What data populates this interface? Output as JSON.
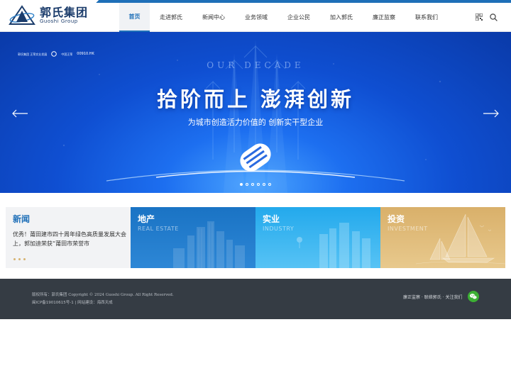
{
  "brand": {
    "name_cn": "郭氏集团",
    "name_en": "Guoshi Group"
  },
  "nav": {
    "items": [
      {
        "label": "首页",
        "active": true
      },
      {
        "label": "走进郭氏",
        "active": false
      },
      {
        "label": "新闻中心",
        "active": false
      },
      {
        "label": "业务领域",
        "active": false
      },
      {
        "label": "企业公民",
        "active": false
      },
      {
        "label": "加入郭氏",
        "active": false
      },
      {
        "label": "廉正监察",
        "active": false
      },
      {
        "label": "联系我们",
        "active": false
      }
    ],
    "qr_icon": "qr-code-icon",
    "search_icon": "search-icon"
  },
  "banner": {
    "partner_text": "郭氏集团 正荣实业发展",
    "partner_brand": "中国正荣",
    "stock_code": "00910.HK",
    "decade": "OUR DECADE",
    "title": "拾阶而上 澎湃创新",
    "subtitle": "为城市创造活力价值的 创新实干型企业",
    "slides": 6,
    "active_slide": 0
  },
  "cards": {
    "news": {
      "title": "新闻",
      "text": "优秀！莆田建市四十周年绿色高质量发展大会上，郭加迪荣获“莆田市荣誉市"
    },
    "estate": {
      "title": "地产",
      "en": "REAL ESTATE"
    },
    "industry": {
      "title": "实业",
      "en": "INDUSTRY"
    },
    "invest": {
      "title": "投资",
      "en": "INVESTMENT"
    }
  },
  "footer": {
    "copyright": "版权所有：郭氏集团 Copyright © 2024 Guoshi Group. All Right Reserved.",
    "icp": "闽ICP备19010615号-1 | 网站建设：海西天成",
    "links": "廉正监察 · 联络郭氏 · 关注我们",
    "wechat_icon": "wechat-icon"
  },
  "colors": {
    "accent": "#1e6fb8",
    "banner_blue": "#0f4fd2",
    "estate": "#1a73c4",
    "industry": "#23a9ec",
    "invest": "#d9b06a",
    "footer": "#353c44"
  }
}
